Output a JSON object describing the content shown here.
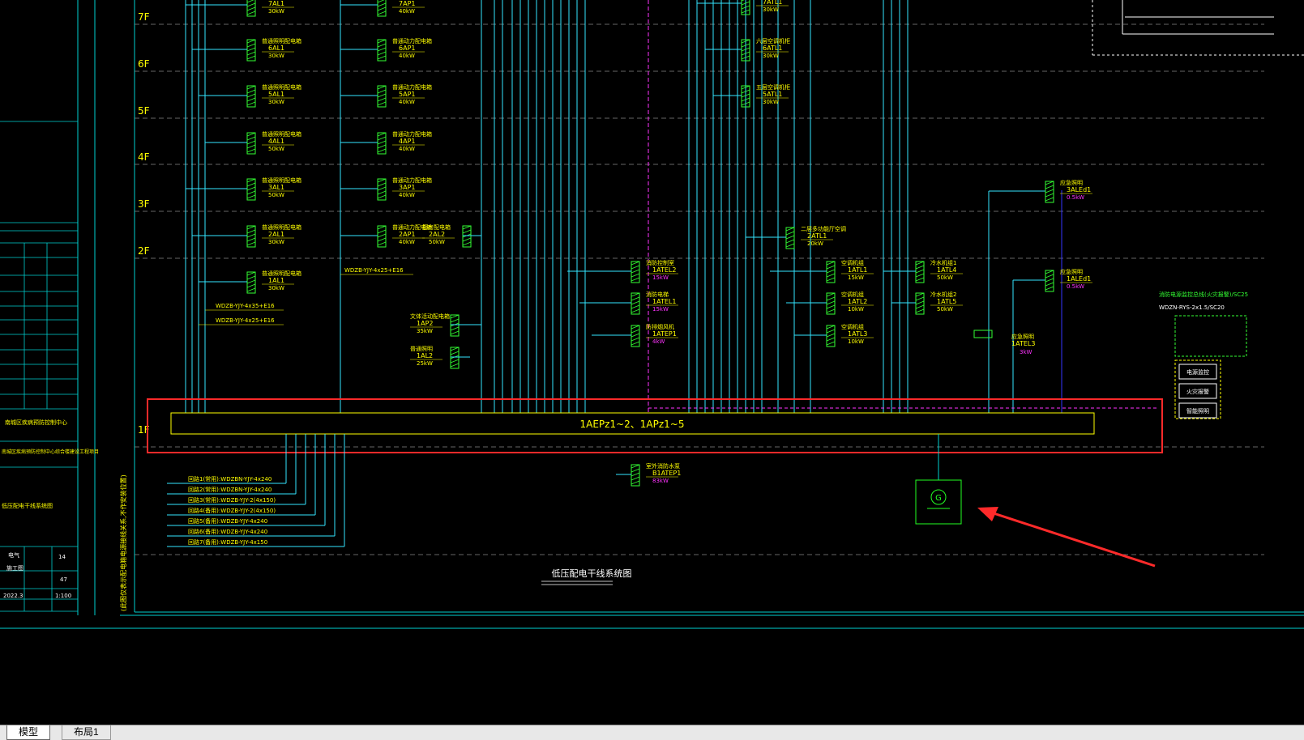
{
  "colors": {
    "background": "#000000",
    "frame": "#00cfcf",
    "bus": "#ffff00",
    "label": "#ffff00",
    "breaker": "#33ff33",
    "highlight": "#ff2a2a",
    "generator": "#22ff22",
    "riser_cyan": "#33e6ff",
    "riser_magenta": "#ff33ff",
    "riser_blue": "#3333ff",
    "rating_magenta": "#ff33ff",
    "white_text": "#ffffff"
  },
  "floors": [
    "7F",
    "6F",
    "5F",
    "4F",
    "3F",
    "2F",
    "1F"
  ],
  "bus_label": "1AEPz1~2、1APz1~5",
  "diagram_title": "低压配电干线系统图",
  "left_column": [
    {
      "name": "普通照明配电箱",
      "id": "7AL1",
      "kw": "30kW"
    },
    {
      "name": "普通照明配电箱",
      "id": "6AL1",
      "kw": "30kW"
    },
    {
      "name": "普通照明配电箱",
      "id": "5AL1",
      "kw": "30kW"
    },
    {
      "name": "普通照明配电箱",
      "id": "4AL1",
      "kw": "50kW"
    },
    {
      "name": "普通照明配电箱",
      "id": "3AL1",
      "kw": "50kW"
    },
    {
      "name": "普通照明配电箱",
      "id": "2AL1",
      "kw": "30kW"
    },
    {
      "name": "普通照明配电箱",
      "id": "1AL1",
      "kw": "30kW"
    }
  ],
  "right_column": [
    {
      "name": "普通动力配电箱",
      "id": "7AP1",
      "kw": "40kW"
    },
    {
      "name": "普通动力配电箱",
      "id": "6AP1",
      "kw": "40kW"
    },
    {
      "name": "普通动力配电箱",
      "id": "5AP1",
      "kw": "40kW"
    },
    {
      "name": "普通动力配电箱",
      "id": "4AP1",
      "kw": "40kW"
    },
    {
      "name": "普通动力配电箱",
      "id": "3AP1",
      "kw": "40kW"
    },
    {
      "name": "普通动力配电箱",
      "id": "2AP1",
      "kw": "40kW"
    }
  ],
  "cable_labels": [
    "WDZB-YJY-4x25+E16",
    "WDZB-YJY-4x35+E16",
    "WDZB-YJY-4x25+E16"
  ],
  "mid_boxes": [
    {
      "name": "厨房配电箱",
      "id": "2AL2",
      "kw": "50kW"
    },
    {
      "name": "文体活动配电箱",
      "id": "1AP2",
      "kw": "35kW"
    },
    {
      "name": "普通照明",
      "id": "1AL2",
      "kw": "25kW"
    }
  ],
  "upper_right_boxes": [
    {
      "name": "六层空调机柜",
      "id": "6ATL1",
      "kw": "30kW"
    },
    {
      "name": "五层空调机柜",
      "id": "5ATL1",
      "kw": "30kW"
    },
    {
      "name": "二层多功能厅空调",
      "id": "2ATL1",
      "kw": "20kW"
    }
  ],
  "ate_boxes": [
    {
      "name": "消防控制室",
      "id": "1ATEL2",
      "kw": "15kW"
    },
    {
      "name": "消防电梯",
      "id": "1ATEL1",
      "kw": "15kW"
    },
    {
      "name": "防排烟风机",
      "id": "1ATEP1",
      "kw": "4kW"
    }
  ],
  "atl_boxes": [
    {
      "name": "空调机组",
      "id": "1ATL1",
      "kw": "15kW"
    },
    {
      "name": "空调机组",
      "id": "1ATL2",
      "kw": "10kW"
    },
    {
      "name": "空调机组",
      "id": "1ATL3",
      "kw": "10kW"
    },
    {
      "name": "冷水机组1",
      "id": "1ATL4",
      "kw": "50kW"
    },
    {
      "name": "冷水机组2",
      "id": "1ATL5",
      "kw": "50kW"
    }
  ],
  "emergency": [
    {
      "name": "应急照明",
      "id": "3ALEd1",
      "kw": "0.5kW"
    },
    {
      "name": "应急照明",
      "id": "1ALEd1",
      "kw": "0.5kW"
    },
    {
      "name": "应急照明",
      "id": "1ATEL3",
      "kw": "3kW"
    }
  ],
  "below_bus_box": {
    "name": "室外消防水泵",
    "id": "B1ATEP1",
    "kw": "83kW"
  },
  "incoming_cables": [
    "回路1(常用):WDZBN-YJY-4x240",
    "回路2(常用):WDZBN-YJY-4x240",
    "回路3(常用):WDZB-YJY-2(4x150)",
    "回路4(备用):WDZB-YJY-2(4x150)",
    "回路5(备用):WDZB-YJY-4x240",
    "回路6(备用):WDZB-YJY-4x240",
    "回路7(备用):WDZB-YJY-4x150"
  ],
  "fire_cable_labels": [
    "消防电源监控总线(火灾报警)/SC25",
    "WDZN-RYS-2x1.5/SC20"
  ],
  "fire_panel_labels": [
    "电源监控",
    "火灾报警",
    "智能照明"
  ],
  "vertical_note": "(此图仅表示配电箱电源接线关系,不作安装位置)",
  "title_block": {
    "org_line": "南城区疾病预防控制中心",
    "project_line": "南城区疾病预防控制中心综合楼建设工程项目",
    "drawing_name": "低压配电干线系统图",
    "sheet_no": "14",
    "total": "47",
    "date": "2022.3",
    "scale": "1:100",
    "discipline": "电气",
    "stage": "施工图"
  },
  "tabs": [
    {
      "label": "模型",
      "active": true
    },
    {
      "label": "布局1",
      "active": false
    }
  ]
}
